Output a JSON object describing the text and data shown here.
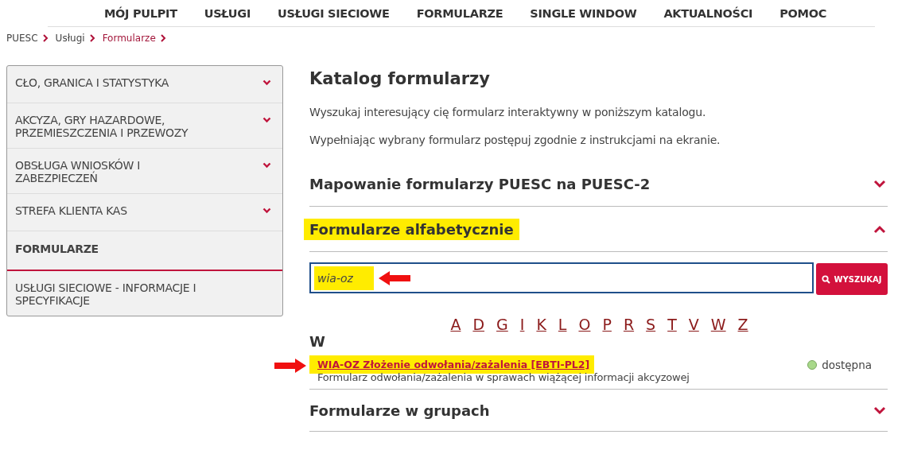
{
  "nav": [
    {
      "label": "MÓJ PULPIT"
    },
    {
      "label": "USŁUGI"
    },
    {
      "label": "USŁUGI SIECIOWE"
    },
    {
      "label": "FORMULARZE"
    },
    {
      "label": "SINGLE WINDOW"
    },
    {
      "label": "AKTUALNOŚCI"
    },
    {
      "label": "POMOC"
    }
  ],
  "breadcrumb": [
    {
      "label": "PUESC",
      "current": false
    },
    {
      "label": "Usługi",
      "current": false
    },
    {
      "label": "Formularze",
      "current": true
    }
  ],
  "sidebar": {
    "items": [
      {
        "label": "CŁO, GRANICA I STATYSTYKA",
        "selected": false,
        "expandable": true
      },
      {
        "label": "AKCYZA, GRY HAZARDOWE, PRZEMIESZCZENIA I PRZEWOZY",
        "selected": false,
        "expandable": true
      },
      {
        "label": "OBSŁUGA WNIOSKÓW I ZABEZPIECZEŃ",
        "selected": false,
        "expandable": true
      },
      {
        "label": "STREFA KLIENTA KAS",
        "selected": false,
        "expandable": true
      },
      {
        "label": "FORMULARZE",
        "selected": true,
        "expandable": false
      },
      {
        "label": "USŁUGI SIECIOWE - INFORMACJE I SPECYFIKACJE",
        "selected": false,
        "expandable": false
      }
    ]
  },
  "main": {
    "title": "Katalog formularzy",
    "intro": [
      "Wyszukaj interesujący cię formularz interaktywny w poniższym katalogu.",
      "Wypełniając wybrany formularz postępuj zgodnie z instrukcjami na ekranie."
    ],
    "sections": [
      {
        "title": "Mapowanie formularzy PUESC na PUESC-2",
        "expanded": false,
        "highlighted": false
      },
      {
        "title": "Formularze alfabetycznie",
        "expanded": true,
        "highlighted": true,
        "search": {
          "value": "wia-oz",
          "highlighted": true,
          "marked": true,
          "button": "WYSZUKAJ"
        },
        "letters": [
          "A",
          "D",
          "G",
          "I",
          "K",
          "L",
          "O",
          "P",
          "R",
          "S",
          "T",
          "V",
          "W",
          "Z"
        ],
        "groups": [
          {
            "letter": "W",
            "forms": [
              {
                "name": "WIA-OZ Złożenie odwołania/zażalenia [EBTI-PL2]",
                "description": "Formularz odwołania/zażalenia w sprawach wiążącej informacji akcyzowej",
                "status": "dostępna",
                "color": "#a8d88a",
                "highlighted": true,
                "marked": true
              }
            ]
          }
        ]
      },
      {
        "title": "Formularze w grupach",
        "expanded": false,
        "highlighted": false
      }
    ]
  }
}
